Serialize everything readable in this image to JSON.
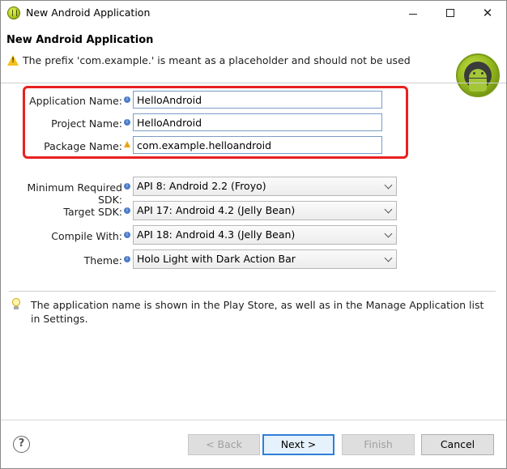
{
  "window": {
    "title": "New Android Application",
    "icon": "eclipse-adt-icon",
    "controls": {
      "minimize": "minimize-icon",
      "maximize": "maximize-icon",
      "close_symbol": "✕"
    }
  },
  "header": {
    "title": "New Android Application",
    "warning_message": "The prefix 'com.example.' is meant as a placeholder and should not be used",
    "logo": "android-logo"
  },
  "form": {
    "application_name": {
      "label": "Application Name:",
      "value": "HelloAndroid"
    },
    "project_name": {
      "label": "Project Name:",
      "value": "HelloAndroid"
    },
    "package_name": {
      "label": "Package Name:",
      "value": "com.example.helloandroid"
    },
    "min_sdk": {
      "label": "Minimum Required SDK:",
      "value": "API 8: Android 2.2 (Froyo)"
    },
    "target_sdk": {
      "label": "Target SDK:",
      "value": "API 17: Android 4.2 (Jelly Bean)"
    },
    "compile_with": {
      "label": "Compile With:",
      "value": "API 18: Android 4.3 (Jelly Bean)"
    },
    "theme": {
      "label": "Theme:",
      "value": "Holo Light with Dark Action Bar"
    }
  },
  "hint": {
    "icon": "lightbulb-icon",
    "text": "The application name is shown in the Play Store, as well as in the Manage Application list in Settings."
  },
  "footer": {
    "help_symbol": "?",
    "back_label": "< Back",
    "next_label": "Next >",
    "finish_label": "Finish",
    "cancel_label": "Cancel"
  },
  "colors": {
    "highlight_border": "#e8211f",
    "default_button_border": "#2f7fd6",
    "warning_yellow": "#f4c21a"
  }
}
